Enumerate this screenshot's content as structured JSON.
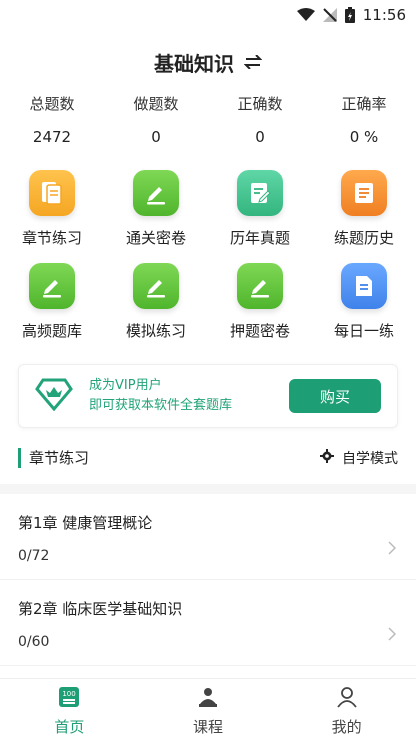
{
  "status_bar": {
    "time": "11:56"
  },
  "header": {
    "title": "基础知识",
    "switch_icon": "swap-icon"
  },
  "stats": [
    {
      "label": "总题数",
      "value": "2472"
    },
    {
      "label": "做题数",
      "value": "0"
    },
    {
      "label": "正确数",
      "value": "0"
    },
    {
      "label": "正确率",
      "value": "0 %"
    }
  ],
  "features": [
    {
      "label": "章节练习",
      "icon": "book-icon",
      "color": "#f5a623"
    },
    {
      "label": "通关密卷",
      "icon": "edit-icon",
      "color": "#5fc53c"
    },
    {
      "label": "历年真题",
      "icon": "notepad-icon",
      "color": "#3dbf8e"
    },
    {
      "label": "练题历史",
      "icon": "book-list-icon",
      "color": "#f08a2c"
    },
    {
      "label": "高频题库",
      "icon": "edit-icon",
      "color": "#5fc53c"
    },
    {
      "label": "模拟练习",
      "icon": "edit-icon",
      "color": "#5fc53c"
    },
    {
      "label": "押题密卷",
      "icon": "edit-icon",
      "color": "#5fc53c"
    },
    {
      "label": "每日一练",
      "icon": "document-icon",
      "color": "#4a8ff0"
    }
  ],
  "vip": {
    "line1": "成为VIP用户",
    "line2": "即可获取本软件全套题库",
    "button": "购买"
  },
  "section": {
    "title": "章节练习",
    "mode": "自学模式"
  },
  "chapters": [
    {
      "title": "第1章 健康管理概论",
      "progress": "0/72"
    },
    {
      "title": "第2章 临床医学基础知识",
      "progress": "0/60"
    }
  ],
  "tabs": [
    {
      "label": "首页",
      "icon": "home-100-icon",
      "active": true
    },
    {
      "label": "课程",
      "icon": "course-icon",
      "active": false
    },
    {
      "label": "我的",
      "icon": "profile-icon",
      "active": false
    }
  ],
  "colors": {
    "accent": "#1e9e74"
  }
}
